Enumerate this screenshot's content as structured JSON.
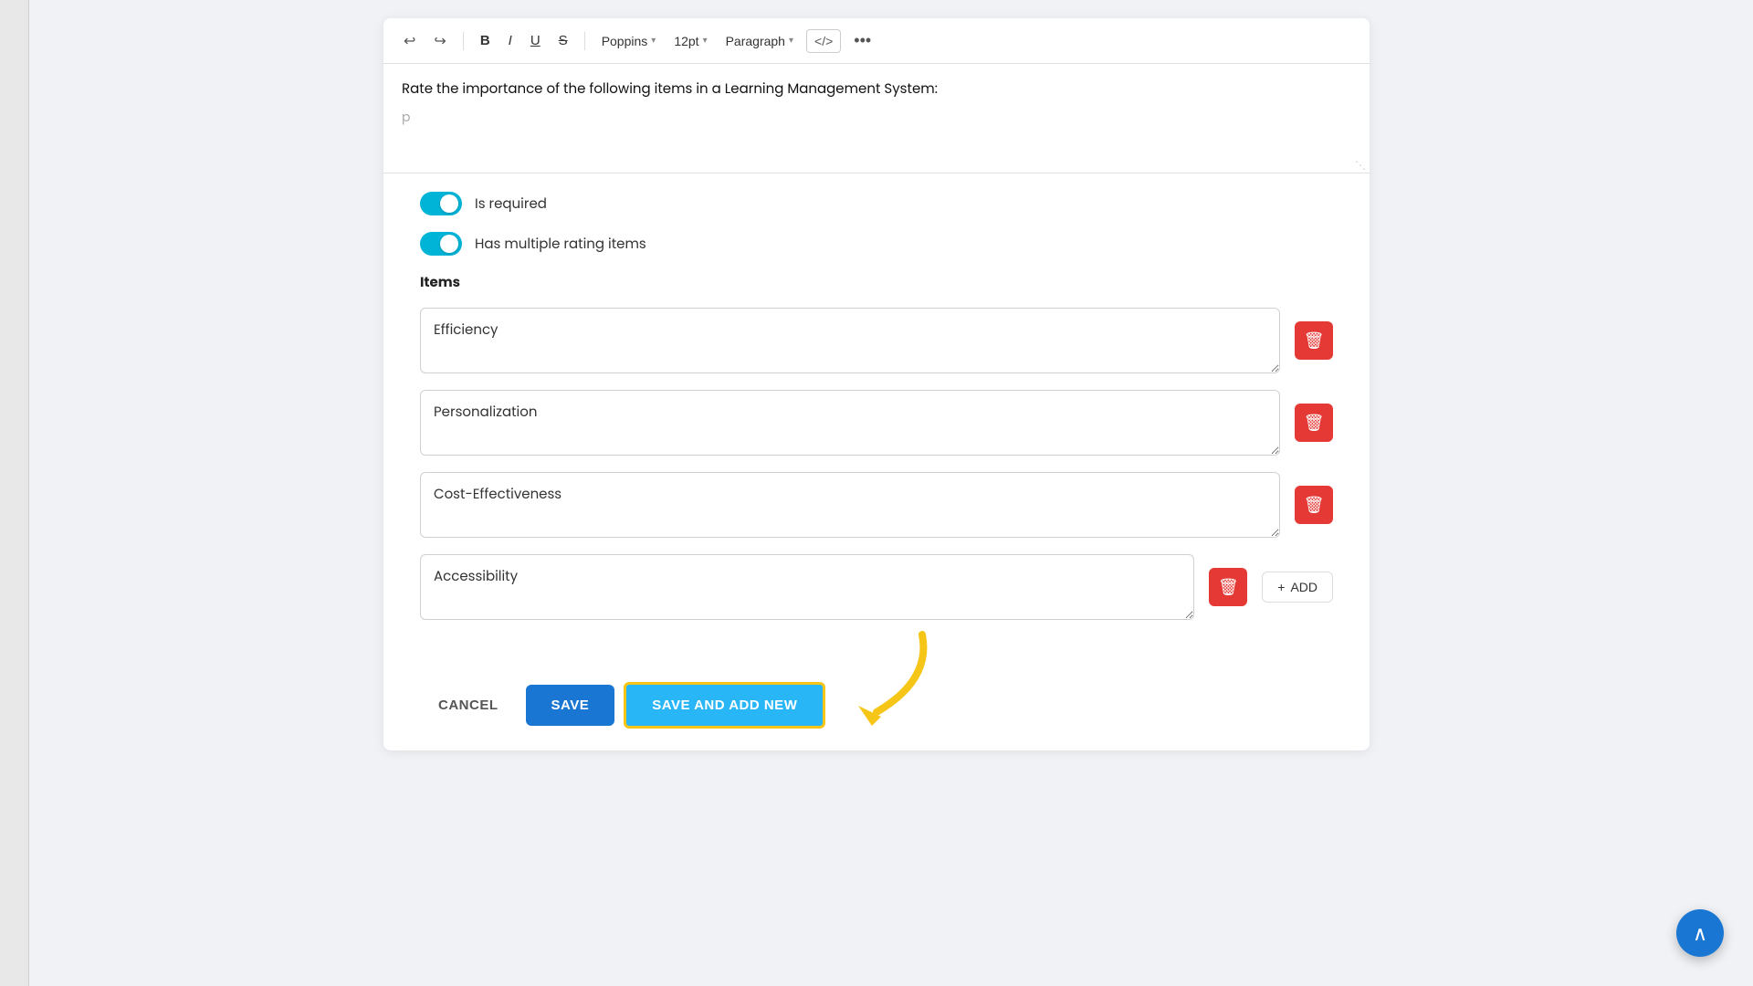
{
  "toolbar": {
    "undo_icon": "↩",
    "redo_icon": "↪",
    "bold_label": "B",
    "italic_label": "I",
    "underline_label": "U",
    "strikethrough_label": "S",
    "font_family": "Poppins",
    "font_size": "12pt",
    "paragraph": "Paragraph",
    "code_icon": "</>",
    "more_icon": "•••"
  },
  "editor": {
    "text": "Rate the importance of the following items in a Learning Management System:",
    "placeholder": "p"
  },
  "toggles": {
    "is_required_label": "Is required",
    "has_multiple_label": "Has multiple rating items"
  },
  "items_section": {
    "label": "Items",
    "items": [
      {
        "value": "Efficiency"
      },
      {
        "value": "Personalization"
      },
      {
        "value": "Cost-Effectiveness"
      },
      {
        "value": "Accessibility"
      }
    ],
    "add_label": "+ ADD"
  },
  "footer": {
    "cancel_label": "CANCEL",
    "save_label": "SAVE",
    "save_add_label": "SAVE AND ADD NEW"
  },
  "colors": {
    "primary": "#1976d2",
    "accent": "#29b6f6",
    "danger": "#e53935",
    "toggle_on": "#00b4d8",
    "arrow": "#f5c518"
  }
}
